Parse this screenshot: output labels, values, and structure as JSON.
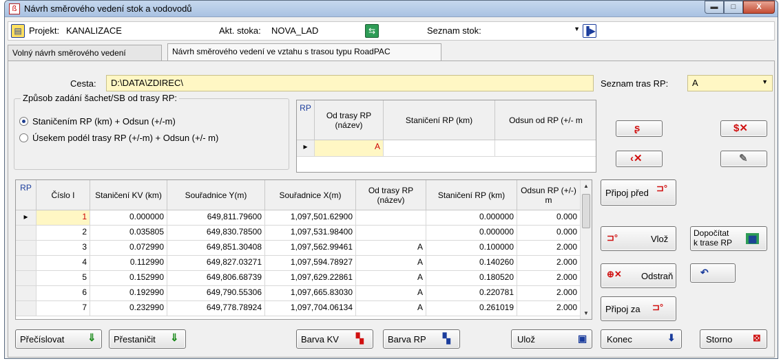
{
  "window": {
    "title": "Návrh směrového vedení stok a vodovodů",
    "btn_min": "▬",
    "btn_max": "□",
    "btn_close": "X"
  },
  "topbar": {
    "project_label": "Projekt:",
    "project_value": "KANALIZACE",
    "current_sewer_label": "Akt. stoka:",
    "current_sewer_value": "NOVA_LAD",
    "sewer_list_label": "Seznam stok:",
    "sewer_list_value": ""
  },
  "tabs": [
    {
      "label": "Volný návrh směrového vedení",
      "active": false
    },
    {
      "label": "Návrh směrového vedení ve vztahu s trasou typu RoadPAC",
      "active": true
    }
  ],
  "path": {
    "label": "Cesta:",
    "value": "D:\\DATA\\ZDIREC\\"
  },
  "rp_routes": {
    "label": "Seznam tras RP:",
    "value": "A"
  },
  "entry_mode": {
    "legend": "Způsob zadání šachet/SB od trasy RP:",
    "options": [
      {
        "label": "Staničením RP (km) + Odsun (+/-m)",
        "checked": true
      },
      {
        "label": "Úsekem podél trasy RP (+/-m) + Odsun (+/- m)",
        "checked": false
      }
    ]
  },
  "rp_grid": {
    "corner": "RP",
    "headers": [
      "Od trasy RP (název)",
      "Staničení RP (km)",
      "Odsun od  RP (+/- m"
    ],
    "row_marker": "▸",
    "row": [
      "A",
      "",
      ""
    ]
  },
  "main_grid": {
    "corner": "RP",
    "headers": [
      "Číslo I",
      "Staničení KV (km)",
      "Souřadnice Y(m)",
      "Souřadnice X(m)",
      "Od trasy RP (název)",
      "Staničení  RP (km)",
      "Odsun RP (+/-) m"
    ],
    "row_marker": "▸",
    "rows": [
      [
        "1",
        "0.000000",
        "649,811.79600",
        "1,097,501.62900",
        "",
        "0.000000",
        "0.000"
      ],
      [
        "2",
        "0.035805",
        "649,830.78500",
        "1,097,531.98400",
        "",
        "0.000000",
        "0.000"
      ],
      [
        "3",
        "0.072990",
        "649,851.30408",
        "1,097,562.99461",
        "A",
        "0.100000",
        "2.000"
      ],
      [
        "4",
        "0.112990",
        "649,827.03271",
        "1,097,594.78927",
        "A",
        "0.140260",
        "2.000"
      ],
      [
        "5",
        "0.152990",
        "649,806.68739",
        "1,097,629.22861",
        "A",
        "0.180520",
        "2.000"
      ],
      [
        "6",
        "0.192990",
        "649,790.55306",
        "1,097,665.83030",
        "A",
        "0.220781",
        "2.000"
      ],
      [
        "7",
        "0.232990",
        "649,778.78924",
        "1,097,704.06134",
        "A",
        "0.261019",
        "2.000"
      ]
    ]
  },
  "buttons": {
    "pripoj_pred": "Připoj před",
    "vloz": "Vlož",
    "dopocitat_1": "Dopočítat",
    "dopocitat_2": "k trase RP",
    "odstran": "Odstraň",
    "pripoj_za": "Připoj za",
    "precislovat": "Přečíslovat",
    "prestanicit": "Přestaničit",
    "barva_kv": "Barva KV",
    "barva_rp": "Barva RP",
    "uloz": "Ulož",
    "konec": "Konec",
    "storno": "Storno"
  },
  "colors": {
    "input_bg": "#fff7c4",
    "title_bg": "#b9cee8",
    "red_icon": "#d01010",
    "green_icon": "#1a8a1a",
    "blue_icon": "#1a3c9c"
  }
}
